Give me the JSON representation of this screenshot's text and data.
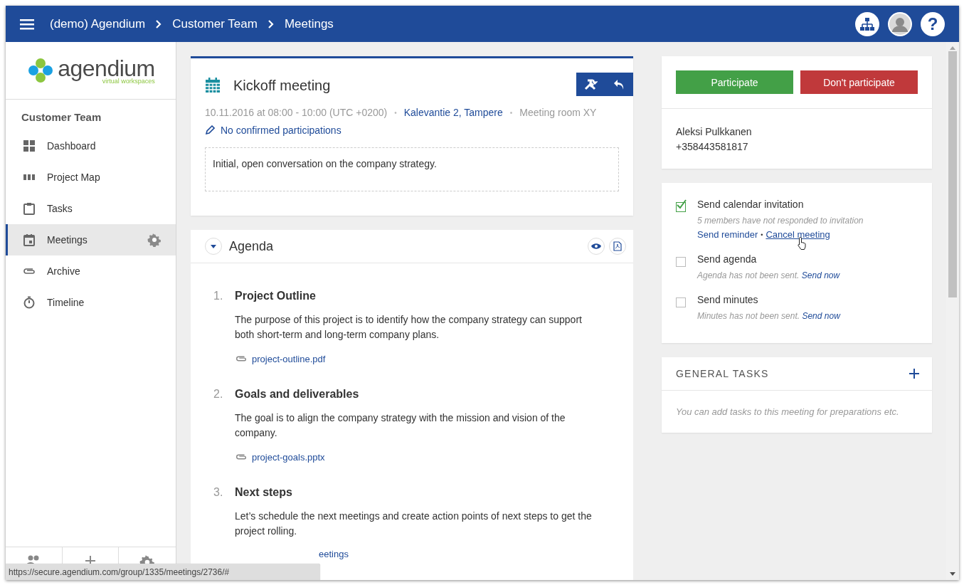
{
  "top_bar": {
    "breadcrumbs": [
      "(demo) Agendium",
      "Customer Team",
      "Meetings"
    ],
    "help_label": "?"
  },
  "sidebar": {
    "logo": {
      "name": "agendium",
      "tagline": "virtual workspaces"
    },
    "group_title": "Customer Team",
    "items": [
      {
        "label": "Dashboard",
        "selected": false
      },
      {
        "label": "Project Map",
        "selected": false
      },
      {
        "label": "Tasks",
        "selected": false
      },
      {
        "label": "Meetings",
        "selected": true
      },
      {
        "label": "Archive",
        "selected": false
      },
      {
        "label": "Timeline",
        "selected": false
      }
    ]
  },
  "meeting": {
    "title": "Kickoff meeting",
    "date": "10.11.2016 at 08:00 - 10:00 (UTC +0200)",
    "separator": "•",
    "location": "Kalevantie 2, Tampere",
    "room": "Meeting room XY",
    "participation": "No confirmed participations",
    "description": "Initial, open conversation on the company strategy."
  },
  "agenda": {
    "title": "Agenda",
    "items": [
      {
        "number": "1.",
        "title": "Project Outline",
        "text": "The purpose of this project is to identify how the company strategy can support both short-term and long-term company plans.",
        "attachment": {
          "name": "project-outline.pdf",
          "covered": false
        }
      },
      {
        "number": "2.",
        "title": "Goals and deliverables",
        "text": "The goal is to align the company strategy with the mission and vision of the company.",
        "attachment": {
          "name": "project-goals.pptx",
          "covered": false
        }
      },
      {
        "number": "3.",
        "title": "Next steps",
        "text": "Let’s schedule the next meetings and create action points of next steps to get the project rolling.",
        "attachment": {
          "name": "eetings",
          "covered": true
        }
      }
    ]
  },
  "rsvp": {
    "buttons": [
      "Participate",
      "Don't participate"
    ],
    "contact": {
      "name": "Aleksi Pulkkanen",
      "phone": "+358443581817"
    }
  },
  "actions": [
    {
      "kind": "invitation",
      "label": "Send calendar invitation",
      "checked": true,
      "note": "5 members have not responded to invitation",
      "separator": "•",
      "links": [
        {
          "label": "Send reminder",
          "hovered": false
        },
        {
          "label": "Cancel meeting",
          "hovered": true
        }
      ]
    },
    {
      "kind": "send",
      "label": "Send agenda",
      "checked": false,
      "note": "Agenda has not been sent.",
      "links": [
        {
          "label": "Send now",
          "hovered": false
        }
      ]
    },
    {
      "kind": "send",
      "label": "Send minutes",
      "checked": false,
      "note": "Minutes has not been sent.",
      "links": [
        {
          "label": "Send now",
          "hovered": false
        }
      ]
    }
  ],
  "general_tasks": {
    "title": "GENERAL TASKS",
    "empty_text": "You can add tasks to this meeting for preparations etc."
  },
  "status_url": "https://secure.agendium.com/group/1335/meetings/2736/#"
}
